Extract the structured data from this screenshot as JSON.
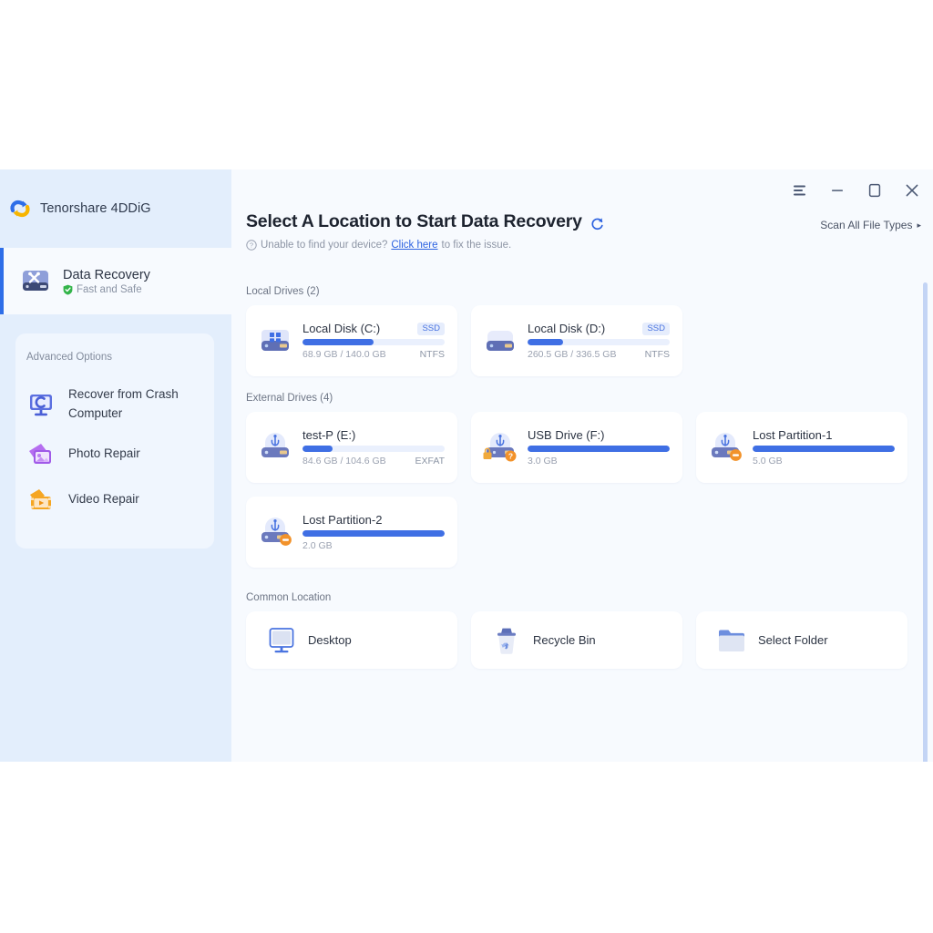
{
  "window": {
    "brand": "Tenorshare 4DDiG",
    "controls": [
      {
        "name": "menu",
        "label": "Menu"
      },
      {
        "name": "minimize",
        "label": "Minimize"
      },
      {
        "name": "maximize",
        "label": "Maximize"
      },
      {
        "name": "close",
        "label": "Close"
      }
    ]
  },
  "sidebar": {
    "active": {
      "title": "Data Recovery",
      "subtitle": "Fast and Safe",
      "icon": "hard-drive-tools-icon"
    },
    "advanced": {
      "title": "Advanced Options",
      "items": [
        {
          "label": "Recover from Crash Computer",
          "icon": "crash-computer-icon"
        },
        {
          "label": "Photo Repair",
          "icon": "photo-repair-icon"
        },
        {
          "label": "Video Repair",
          "icon": "video-repair-icon"
        }
      ]
    }
  },
  "header": {
    "title": "Select A Location to Start Data Recovery",
    "refresh_icon": "refresh-icon",
    "scan_all": "Scan All File Types",
    "scan_all_caret": "▸",
    "hint_prefix": "Unable to find your device?",
    "hint_link": "Click here",
    "hint_suffix": "to fix the issue."
  },
  "sections": {
    "local": {
      "label": "Local Drives (2)",
      "drives": [
        {
          "name": "Local Disk (C:)",
          "tag": "SSD",
          "usage": "68.9 GB / 140.0 GB",
          "filesystem": "NTFS",
          "fill_percent": 50,
          "icon": "windows-disk-icon"
        },
        {
          "name": "Local Disk (D:)",
          "tag": "SSD",
          "usage": "260.5 GB / 336.5 GB",
          "filesystem": "NTFS",
          "fill_percent": 25,
          "icon": "disk-icon"
        }
      ]
    },
    "external": {
      "label": "External Drives (4)",
      "drives": [
        {
          "name": "test-P (E:)",
          "tag": "",
          "usage": "84.6 GB / 104.6 GB",
          "filesystem": "EXFAT",
          "fill_percent": 21,
          "icon": "usb-drive-icon",
          "badge": ""
        },
        {
          "name": "USB Drive (F:)",
          "tag": "",
          "usage": "3.0 GB",
          "filesystem": "",
          "fill_percent": 100,
          "icon": "usb-drive-icon",
          "badge": "locked-unknown"
        },
        {
          "name": "Lost Partition-1",
          "tag": "",
          "usage": "5.0 GB",
          "filesystem": "",
          "fill_percent": 100,
          "icon": "usb-drive-icon",
          "badge": "lost-partition"
        },
        {
          "name": "Lost Partition-2",
          "tag": "",
          "usage": "2.0 GB",
          "filesystem": "",
          "fill_percent": 100,
          "icon": "usb-drive-icon",
          "badge": "lost-partition"
        }
      ]
    },
    "common": {
      "label": "Common Location",
      "items": [
        {
          "label": "Desktop",
          "icon": "desktop-icon"
        },
        {
          "label": "Recycle Bin",
          "icon": "recycle-bin-icon"
        },
        {
          "label": "Select Folder",
          "icon": "folder-icon"
        }
      ]
    }
  },
  "colors": {
    "accent": "#3f6fe4",
    "sidebar": "#e3eefc",
    "content": "#f7fafe",
    "badge_orange": "#f29528",
    "link": "#2c62e0"
  }
}
